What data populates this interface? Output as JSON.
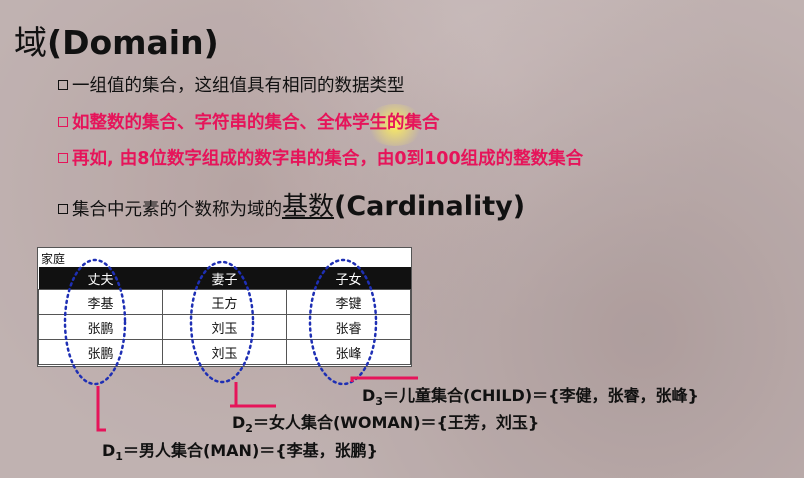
{
  "slide": {
    "title_zh": "域",
    "title_en": "(Domain)"
  },
  "bullets": [
    "一组值的集合，这组值具有相同的数据类型",
    "如整数的集合、字符串的集合、全体学生的集合",
    "再如, 由8位数字组成的数字串的集合，由0到100组成的整数集合"
  ],
  "cardinality": {
    "text": "集合中元素的个数称为域的",
    "term_zh": "基数",
    "term_en": "(Cardinality)"
  },
  "table": {
    "caption": "家庭",
    "headers": [
      "丈夫",
      "妻子",
      "子女"
    ],
    "rows": [
      [
        "李基",
        "王方",
        "李键"
      ],
      [
        "张鹏",
        "刘玉",
        "张睿"
      ],
      [
        "张鹏",
        "刘玉",
        "张峰"
      ]
    ]
  },
  "annotations": {
    "d3": {
      "letter": "D",
      "sub": "3",
      "text": "＝儿童集合(CHILD)＝{李健，张睿，张峰}"
    },
    "d2": {
      "letter": "D",
      "sub": "2",
      "text": "＝女人集合(WOMAN)＝{王芳，刘玉}"
    },
    "d1": {
      "letter": "D",
      "sub": "1",
      "text": "＝男人集合(MAN)＝{李基，张鹏}"
    }
  },
  "colors": {
    "accent": "#e6145a",
    "ellipse": "#1e2fb4"
  }
}
